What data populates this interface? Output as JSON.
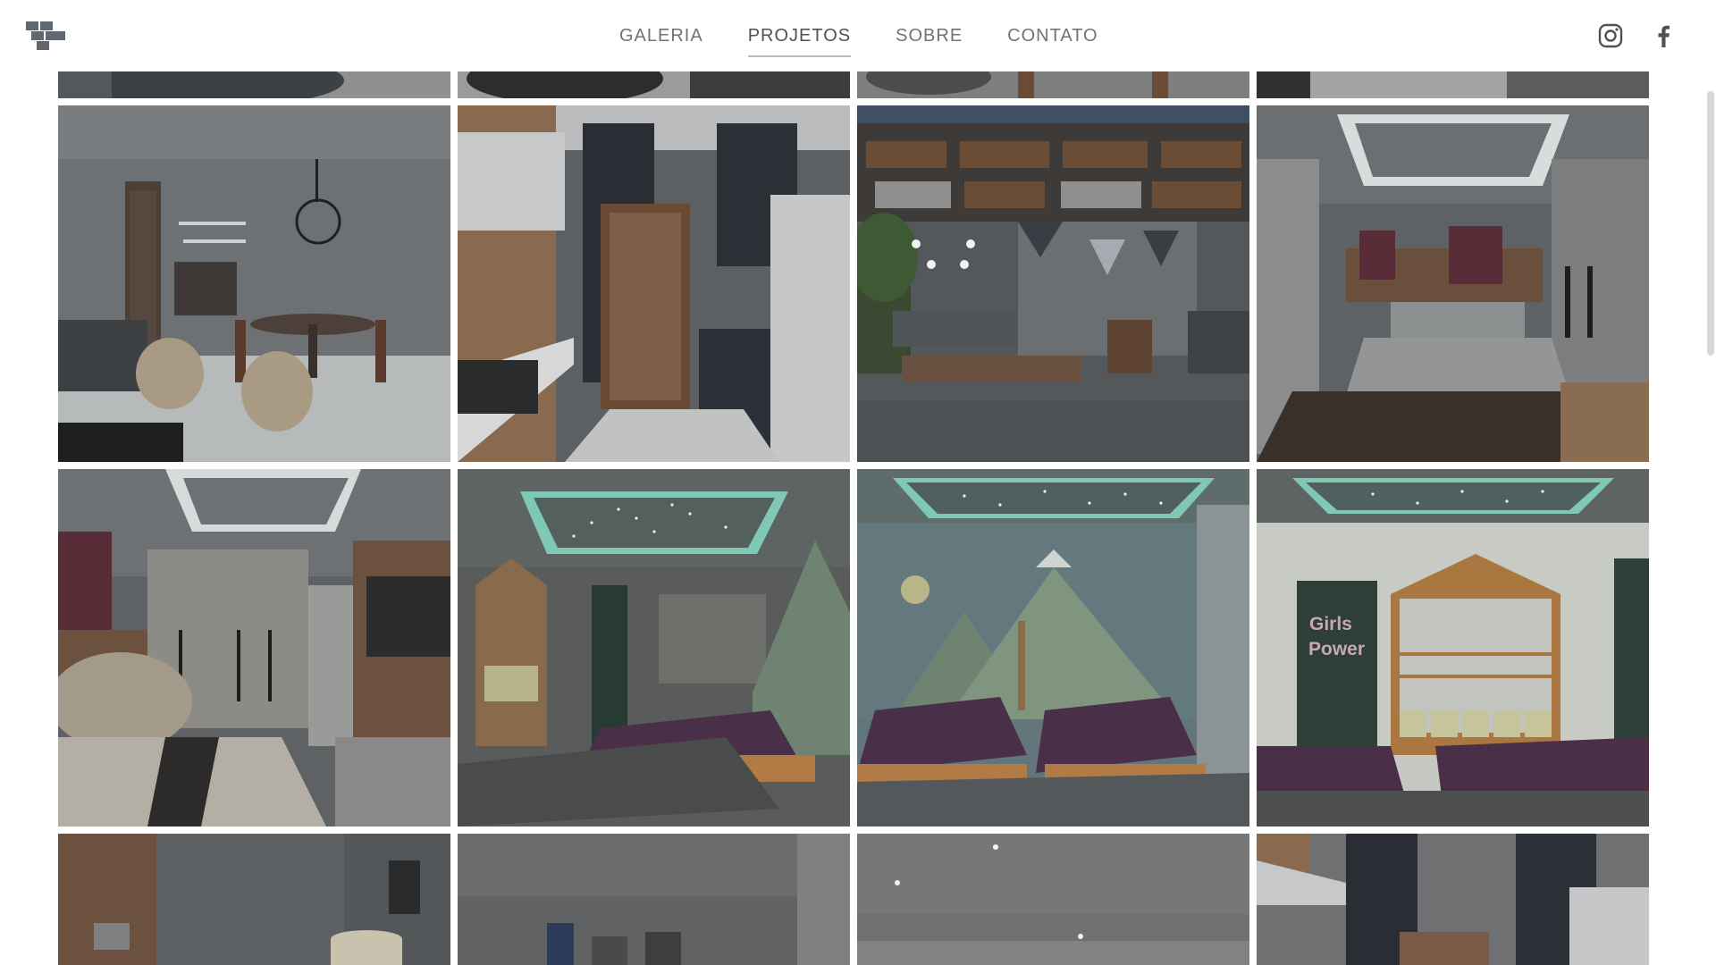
{
  "nav": {
    "items": [
      {
        "label": "GALERIA",
        "active": false
      },
      {
        "label": "PROJETOS",
        "active": true
      },
      {
        "label": "SOBRE",
        "active": false
      },
      {
        "label": "CONTATO",
        "active": false
      }
    ]
  },
  "social": {
    "instagram_icon": "instagram-icon",
    "facebook_icon": "facebook-icon"
  },
  "gallery": {
    "door_text": [
      "Girls",
      "Power"
    ]
  },
  "colors": {
    "nav_text": "#6f7479",
    "nav_active": "#4d5258",
    "logo": "#5f6870"
  }
}
